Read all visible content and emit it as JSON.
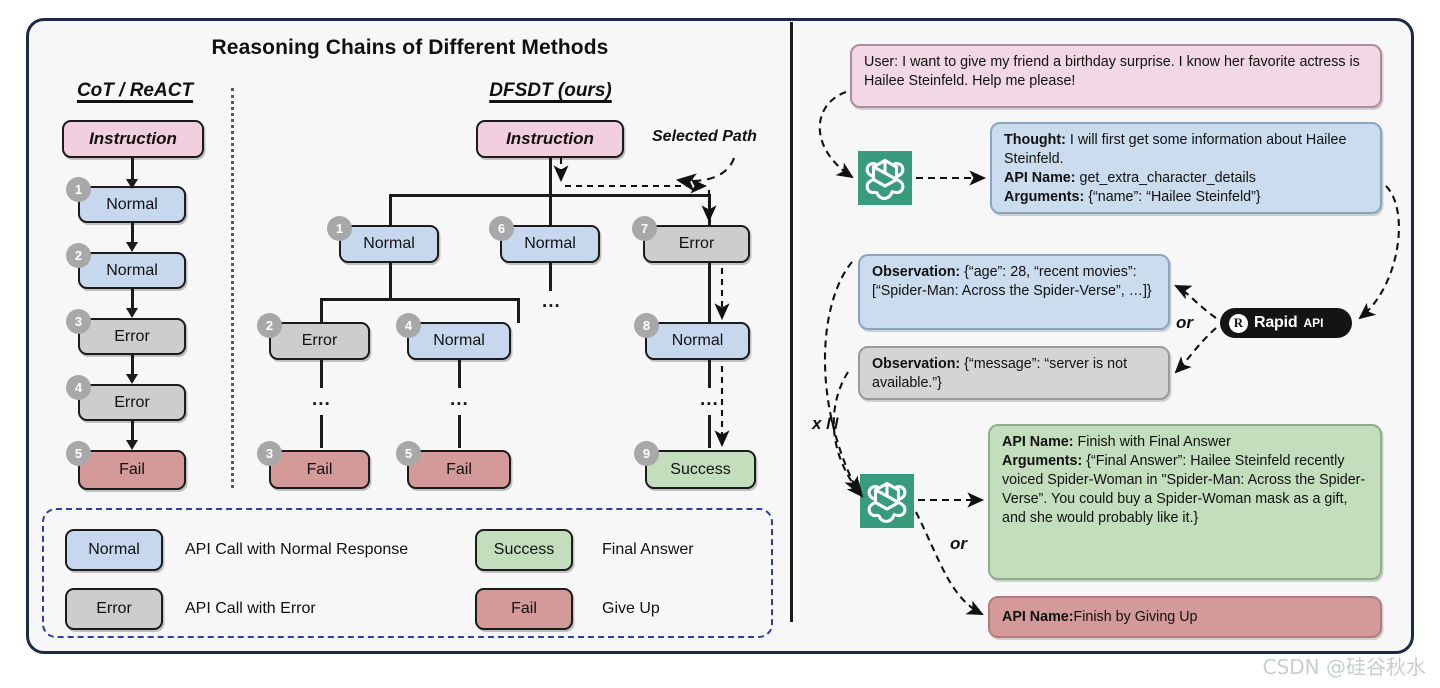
{
  "figure": {
    "title": "Reasoning Chains of Different Methods",
    "watermark": "CSDN @硅谷秋水"
  },
  "left": {
    "cot": {
      "heading": "CoT / ReACT",
      "instruction": "Instruction",
      "nodes": [
        {
          "id": "1",
          "label": "Normal",
          "kind": "normal"
        },
        {
          "id": "2",
          "label": "Normal",
          "kind": "normal"
        },
        {
          "id": "3",
          "label": "Error",
          "kind": "error"
        },
        {
          "id": "4",
          "label": "Error",
          "kind": "error"
        },
        {
          "id": "5",
          "label": "Fail",
          "kind": "fail"
        }
      ]
    },
    "dfsdt": {
      "heading": "DFSDT (ours)",
      "instruction": "Instruction",
      "selected_path_label": "Selected Path",
      "ellipsis": "...",
      "nodes": [
        {
          "id": "1",
          "label": "Normal",
          "kind": "normal"
        },
        {
          "id": "2",
          "label": "Error",
          "kind": "error"
        },
        {
          "id": "3",
          "label": "Fail",
          "kind": "fail"
        },
        {
          "id": "4",
          "label": "Normal",
          "kind": "normal"
        },
        {
          "id": "5",
          "label": "Fail",
          "kind": "fail"
        },
        {
          "id": "6",
          "label": "Normal",
          "kind": "normal"
        },
        {
          "id": "7",
          "label": "Error",
          "kind": "error"
        },
        {
          "id": "8",
          "label": "Normal",
          "kind": "normal"
        },
        {
          "id": "9",
          "label": "Success",
          "kind": "success"
        }
      ]
    },
    "legend": [
      {
        "box": "Normal",
        "desc": "API Call with Normal Response",
        "color": "#c7d8ee"
      },
      {
        "box": "Success",
        "desc": "Final Answer",
        "color": "#c3debc"
      },
      {
        "box": "Error",
        "desc": "API Call with Error",
        "color": "#cdcdcd"
      },
      {
        "box": "Fail",
        "desc": "Give Up",
        "color": "#d49a9a"
      }
    ]
  },
  "right": {
    "user_message": "User: I want to give my friend a birthday surprise. I know her favorite actress is Hailee Steinfeld. Help me please!",
    "thought": {
      "thought_label": "Thought:",
      "thought_text": " I will first get some information about Hailee Steinfeld.",
      "api_label": "API Name:",
      "api_value": " get_extra_character_details",
      "args_label": "Arguments:",
      "args_value": " {“name”: “Hailee Steinfeld”}"
    },
    "observation_ok": {
      "label": "Observation:",
      "text": " {“age”: 28, “recent movies”: [“Spider-Man: Across the Spider-Verse”, …]}"
    },
    "observation_err": {
      "label": "Observation:",
      "text": " {“message”: “server is not available.”}"
    },
    "final_answer": {
      "api_label": "API Name:",
      "api_value": "  Finish with Final Answer",
      "args_label": "Arguments:",
      "args_value": " {“Final Answer”: Hailee Steinfeld recently voiced Spider-Woman in \"Spider-Man: Across the Spider-Verse”.  You could buy a Spider-Woman mask as a gift, and she would probably like it.}"
    },
    "give_up": {
      "api_label": "API Name:",
      "api_value": "  Finish by Giving Up"
    },
    "or_label_1": "or",
    "or_label_2": "or",
    "repeat_label": "x N",
    "llm_icon_name": "openai-logo",
    "tool_service": {
      "name_1": "Rapid",
      "name_2": "API",
      "mark": "R"
    }
  },
  "colors": {
    "normal": "#c7d8ee",
    "error": "#cdcdcd",
    "fail": "#d49a9a",
    "success": "#c3debc",
    "instruction": "#f2cfdf",
    "panel_border": "#1d2b4a",
    "legend_border": "#2b3fa0",
    "llm_green": "#379b7c",
    "rapidapi_black": "#141414"
  }
}
